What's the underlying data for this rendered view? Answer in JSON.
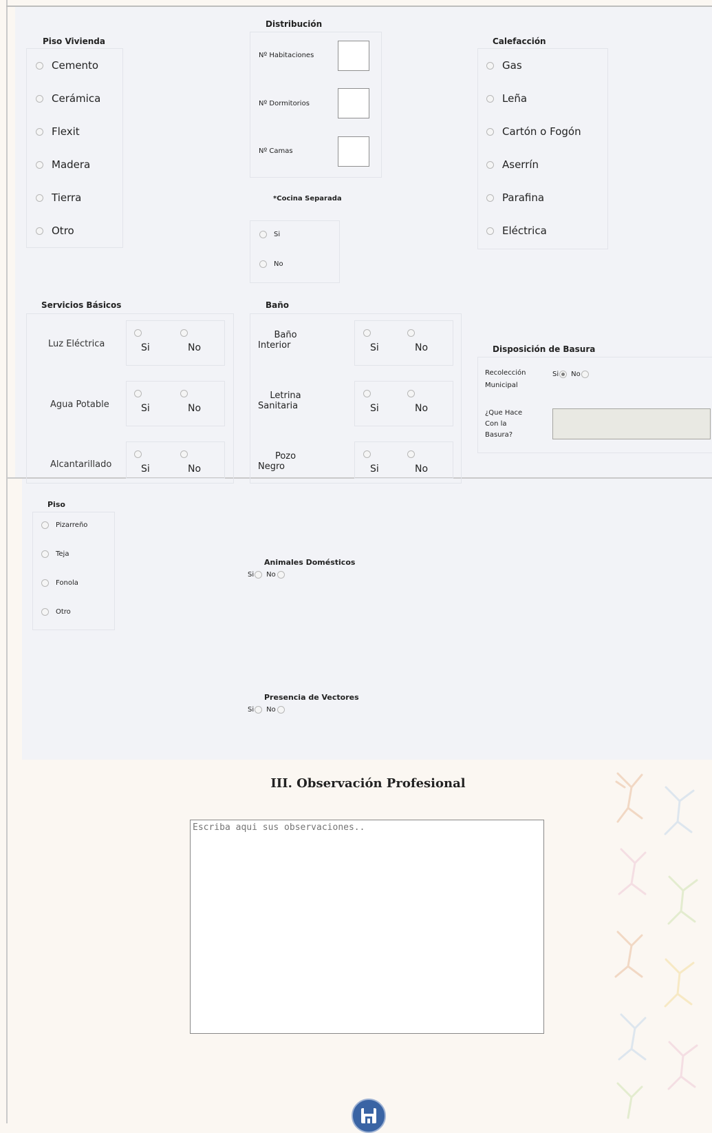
{
  "piso_vivienda": {
    "title": "Piso Vivienda",
    "options": [
      "Cemento",
      "Cerámica",
      "Flexit",
      "Madera",
      "Tierra",
      "Otro"
    ]
  },
  "distribucion": {
    "title": "Distribución",
    "fields": [
      {
        "label": "Nº Habitaciones",
        "value": ""
      },
      {
        "label": "Nº Dormitorios",
        "value": ""
      },
      {
        "label": "Nº Camas",
        "value": ""
      }
    ]
  },
  "cocina": {
    "title": "*Cocina Separada",
    "options": [
      "Si",
      "No"
    ]
  },
  "calefaccion": {
    "title": "Calefacción",
    "options": [
      "Gas",
      "Leña",
      "Cartón o Fogón",
      "Aserrín",
      "Parafina",
      "Eléctrica"
    ]
  },
  "servicios": {
    "title": "Servicios Básicos",
    "rows": [
      {
        "label": "Luz Eléctrica",
        "yes": "Si",
        "no": "No"
      },
      {
        "label": "Agua Potable",
        "yes": "Si",
        "no": "No"
      },
      {
        "label": "Alcantarillado",
        "yes": "Si",
        "no": "No"
      }
    ]
  },
  "bano": {
    "title": "Baño",
    "rows": [
      {
        "label_line1": "Baño",
        "label_line2": "Interior",
        "yes": "Si",
        "no": "No"
      },
      {
        "label_line1": "Letrina",
        "label_line2": "Sanitaria",
        "yes": "Si",
        "no": "No"
      },
      {
        "label_line1": "Pozo",
        "label_line2": "Negro",
        "yes": "Si",
        "no": "No"
      }
    ]
  },
  "basura": {
    "title": "Disposición de Basura",
    "recoleccion_line1": "Recolección",
    "recoleccion_line2": "Municipal",
    "yes": "Si",
    "no": "No",
    "selected": "Si",
    "que_hace_line1": "¿Que Hace",
    "que_hace_line2": "Con la",
    "que_hace_line3": "Basura?",
    "que_hace_value": ""
  },
  "piso_techo": {
    "title": "Piso",
    "options": [
      "Pizarreño",
      "Teja",
      "Fonola",
      "Otro"
    ]
  },
  "animales": {
    "title": "Animales Domésticos",
    "yes": "Si",
    "no": "No"
  },
  "vectores": {
    "title": "Presencia de Vectores",
    "yes": "Si",
    "no": "No"
  },
  "observacion": {
    "heading": "III. Observación Profesional",
    "placeholder": "Escriba aqui sus observaciones.."
  },
  "save": {
    "icon": "floppy-disk-icon",
    "color": "#3a64a4"
  }
}
